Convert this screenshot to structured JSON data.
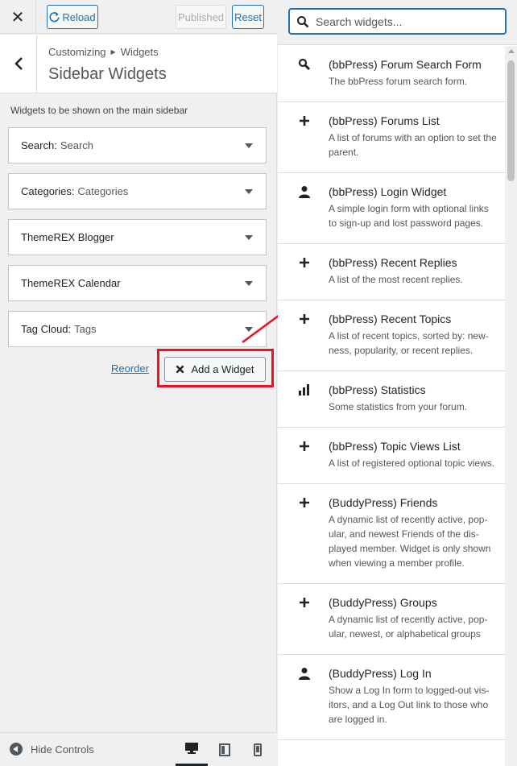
{
  "topbar": {
    "close_icon": "close-icon",
    "reload_label": "Reload",
    "published_label": "Published",
    "reset_label": "Reset"
  },
  "header": {
    "breadcrumb_parent": "Customizing",
    "breadcrumb_child": "Widgets",
    "title": "Sidebar Widgets"
  },
  "description": "Widgets to be shown on the main sidebar",
  "widgets": [
    {
      "name": "Search:",
      "title": "Search"
    },
    {
      "name": "Categories:",
      "title": "Categories"
    },
    {
      "name": "ThemeREX Blogger",
      "title": ""
    },
    {
      "name": "ThemeREX Calendar",
      "title": ""
    },
    {
      "name": "Tag Cloud:",
      "title": "Tags"
    }
  ],
  "actions": {
    "reorder_label": "Reorder",
    "add_widget_label": "Add a Widget"
  },
  "footer": {
    "hide_controls_label": "Hide Controls",
    "devices": [
      "desktop",
      "tablet",
      "mobile"
    ]
  },
  "search": {
    "placeholder": "Search widgets..."
  },
  "available_widgets": [
    {
      "icon": "search-icon",
      "name": "(bbPress) Forum Search Form",
      "desc": "The bbPress forum search form."
    },
    {
      "icon": "plus-icon",
      "name": "(bbPress) Forums List",
      "desc": "A list of forums with an option to set the parent."
    },
    {
      "icon": "user-icon",
      "name": "(bbPress) Login Widget",
      "desc": "A simple login form with optional links to sign-up and lost password pages."
    },
    {
      "icon": "plus-icon",
      "name": "(bbPress) Recent Replies",
      "desc": "A list of the most recent replies."
    },
    {
      "icon": "plus-icon",
      "name": "(bbPress) Recent Topics",
      "desc": "A list of recent topics, sorted by: new­ness, popularity, or recent replies."
    },
    {
      "icon": "chart-bar-icon",
      "name": "(bbPress) Statistics",
      "desc": "Some statistics from your forum."
    },
    {
      "icon": "plus-icon",
      "name": "(bbPress) Topic Views List",
      "desc": "A list of registered optional topic views."
    },
    {
      "icon": "plus-icon",
      "name": "(BuddyPress) Friends",
      "desc": "A dynamic list of recently active, pop­ular, and newest Friends of the dis­played member. Widget is only shown when viewing a member profile."
    },
    {
      "icon": "plus-icon",
      "name": "(BuddyPress) Groups",
      "desc": "A dynamic list of recently active, pop­ular, newest, or alphabetical groups"
    },
    {
      "icon": "user-icon",
      "name": "(BuddyPress) Log In",
      "desc": "Show a Log In form to logged-out vis­itors, and a Log Out link to those who are logged in."
    }
  ],
  "colors": {
    "accent": "#2271b1",
    "highlight": "#e8131f"
  }
}
